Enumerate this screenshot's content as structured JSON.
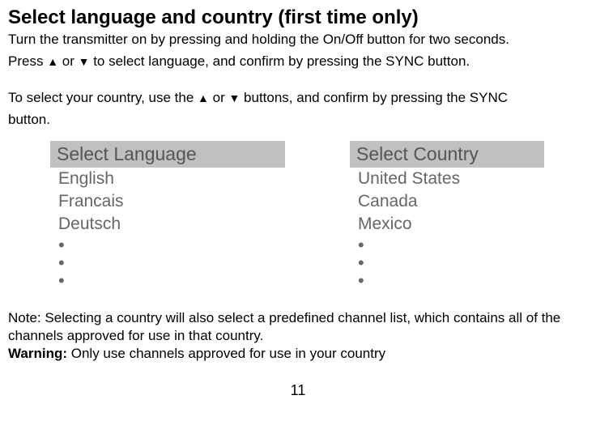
{
  "title": "Select language and country (first time only)",
  "para1a": "Turn the transmitter on by pressing and holding the On/Off button for two seconds.",
  "para1b_pre": "Press ",
  "para1b_mid": " or ",
  "para1b_post": " to select language, and confirm by pressing the SYNC button.",
  "para2_pre": "To select your country, use the ",
  "para2_mid": " or ",
  "para2_post": " buttons, and confirm by pressing the SYNC",
  "para2_last": "button.",
  "up_symbol": "▲",
  "down_symbol": "▼",
  "language": {
    "header": "Select Language",
    "items": [
      "English",
      "Francais",
      "Deutsch"
    ]
  },
  "country": {
    "header": "Select Country",
    "items": [
      "United States",
      "Canada",
      "Mexico"
    ]
  },
  "bullet": "•",
  "note": "Note: Selecting a country will also select a predefined channel list, which contains all of the channels approved for use in that country.",
  "warning_label": "Warning:",
  "warning_text": " Only use channels approved for use in your country",
  "page_number": "11"
}
